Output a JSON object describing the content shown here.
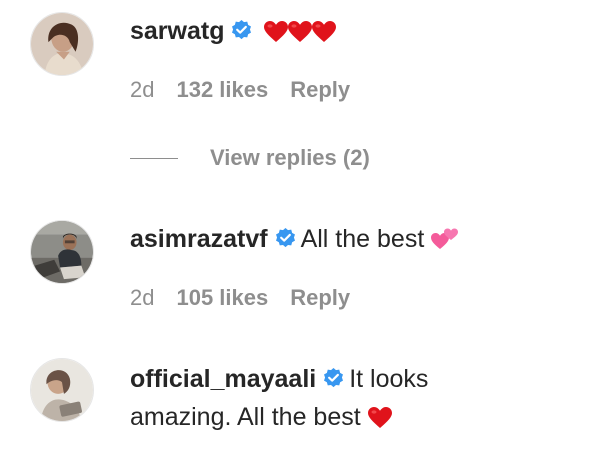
{
  "comments": [
    {
      "username": "sarwatg",
      "verified": true,
      "text": "",
      "emoji": [
        "red-heart",
        "red-heart",
        "red-heart"
      ],
      "time": "2d",
      "likes": "132 likes",
      "reply": "Reply",
      "view_replies": "View replies (2)"
    },
    {
      "username": "asimrazatvf",
      "verified": true,
      "text": "All the best",
      "emoji": [
        "two-hearts"
      ],
      "time": "2d",
      "likes": "105 likes",
      "reply": "Reply"
    },
    {
      "username": "official_mayaali",
      "verified": true,
      "text": "It looks",
      "text_line2": "amazing. All the best",
      "emoji": [
        "red-heart"
      ]
    }
  ],
  "colors": {
    "primary_text": "#262626",
    "secondary_text": "#8e8e8e",
    "verified_blue": "#3897f0",
    "heart_red": "#e0131b",
    "heart_pink": "#f45b9a"
  }
}
